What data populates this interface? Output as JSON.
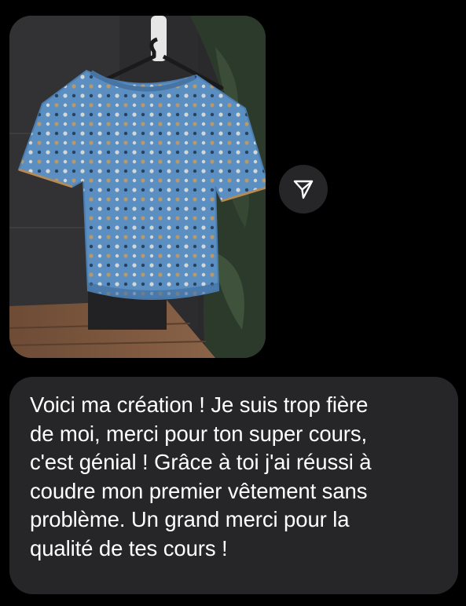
{
  "conversation": {
    "photo": {
      "subject": "blue-polka-dot-top-on-hanger"
    },
    "share_button": {
      "icon": "send-paper-plane-icon"
    },
    "message": {
      "text": "Voici ma création ! Je suis trop fière\nde moi, merci pour ton super cours,\nc'est génial ! Grâce à toi j'ai réussi à\ncoudre mon premier vêtement sans\nproblème. Un grand merci pour la\nqualité de tes cours !"
    }
  },
  "colors": {
    "background": "#000000",
    "bubble": "#262628",
    "text": "#ffffff",
    "shirt": "#5b8fc2"
  }
}
